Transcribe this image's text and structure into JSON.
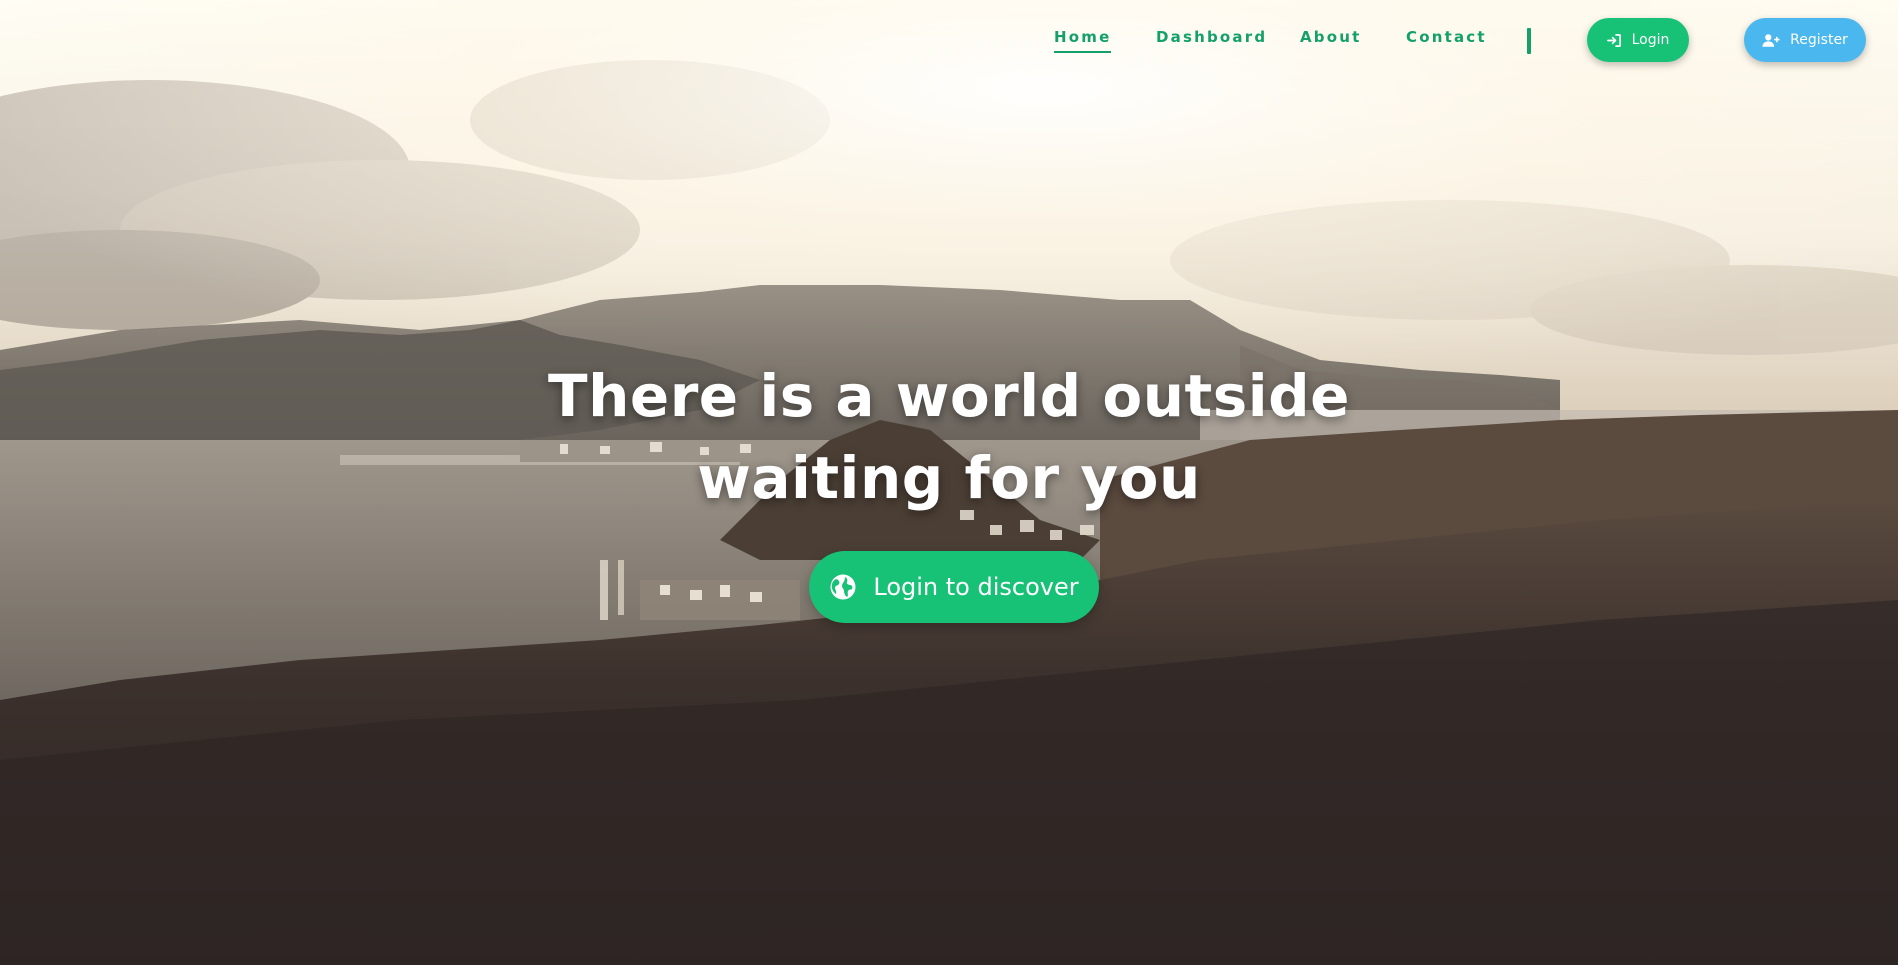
{
  "nav": {
    "links": [
      {
        "label": "Home",
        "active": true
      },
      {
        "label": "Dashboard",
        "active": false
      },
      {
        "label": "About",
        "active": false
      },
      {
        "label": "Contact",
        "active": false
      }
    ],
    "login_label": "Login",
    "login_icon": "sign-in-icon",
    "register_label": "Register",
    "register_icon": "user-plus-icon"
  },
  "hero": {
    "headline": "There is a world outside waiting for you",
    "cta_label": "Login to discover",
    "cta_icon": "globe-icon",
    "background": "landscape photo: coastline, bay with harbor town, mountains under cloudy sky"
  },
  "colors": {
    "accent_green": "#17c277",
    "nav_text_green": "#14a06a",
    "register_blue": "#4ab7ee",
    "headline_white": "#ffffff"
  }
}
